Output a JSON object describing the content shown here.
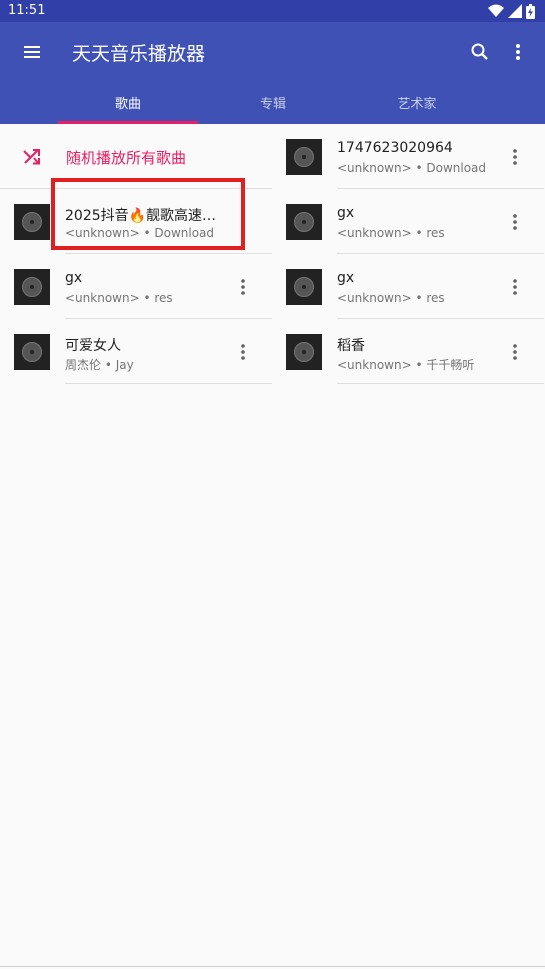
{
  "status_bar": {
    "time": "11:51"
  },
  "app_bar": {
    "title": "天天音乐播放器"
  },
  "tabs": [
    {
      "label": "歌曲",
      "active": true
    },
    {
      "label": "专辑",
      "active": false
    },
    {
      "label": "艺术家",
      "active": false
    }
  ],
  "shuffle": {
    "label": "随机播放所有歌曲"
  },
  "songs": [
    {
      "title": "1747623020964",
      "artist": "<unknown>",
      "album": "Download"
    },
    {
      "title": "2025抖音🔥靓歌高速…",
      "artist": "<unknown>",
      "album": "Download"
    },
    {
      "title": "gx",
      "artist": "<unknown>",
      "album": "res"
    },
    {
      "title": "gx",
      "artist": "<unknown>",
      "album": "res"
    },
    {
      "title": "gx",
      "artist": "<unknown>",
      "album": "res"
    },
    {
      "title": "可爱女人",
      "artist": "周杰伦",
      "album": "Jay"
    },
    {
      "title": "稻香",
      "artist": "<unknown>",
      "album": "千千畅听"
    }
  ],
  "separator": "•",
  "colors": {
    "primary": "#3f51b5",
    "status_bar": "#3040a8",
    "accent": "#e91e63",
    "highlight": "#e02020"
  }
}
